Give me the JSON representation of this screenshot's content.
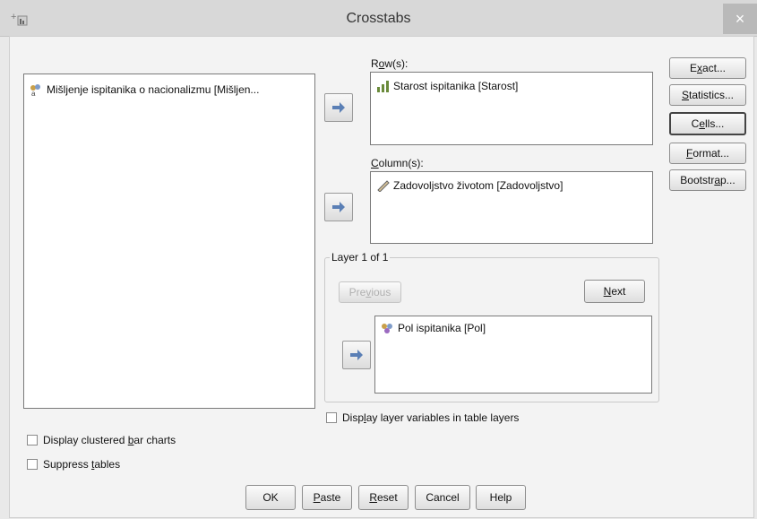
{
  "window": {
    "title": "Crosstabs",
    "close_glyph": "×"
  },
  "source_list": {
    "items": [
      {
        "label": "Mišljenje ispitanika o nacionalizmu [Mišljen...",
        "icon": "nominal-string-icon"
      }
    ]
  },
  "rows": {
    "label_pre": "R",
    "label_u": "o",
    "label_post": "w(s):",
    "items": [
      {
        "label": "Starost ispitanika [Starost]",
        "icon": "ordinal-icon"
      }
    ]
  },
  "columns": {
    "label_pre": "",
    "label_u": "C",
    "label_post": "olumn(s):",
    "items": [
      {
        "label": "Zadovoljstvo životom [Zadovoljstvo]",
        "icon": "scale-icon"
      }
    ]
  },
  "layer": {
    "title": "Layer 1 of 1",
    "previous": {
      "pre": "Pre",
      "u": "v",
      "post": "ious"
    },
    "next": {
      "pre": "",
      "u": "N",
      "post": "ext"
    },
    "items": [
      {
        "label": "Pol ispitanika [Pol]",
        "icon": "nominal-icon"
      }
    ]
  },
  "side_buttons": {
    "exact": {
      "pre": "E",
      "u": "x",
      "post": "act..."
    },
    "statistics": {
      "pre": "",
      "u": "S",
      "post": "tatistics..."
    },
    "cells": {
      "pre": "C",
      "u": "e",
      "post": "lls..."
    },
    "format": {
      "pre": "",
      "u": "F",
      "post": "ormat..."
    },
    "bootstrap": {
      "pre": "Bootstr",
      "u": "a",
      "post": "p..."
    }
  },
  "options": {
    "layer_vars": {
      "pre": "Disp",
      "u": "l",
      "post": "ay layer variables in table layers",
      "checked": false
    },
    "clustered": {
      "pre": "Display clustered ",
      "u": "b",
      "post": "ar charts",
      "checked": false
    },
    "suppress": {
      "pre": "Suppress ",
      "u": "t",
      "post": "ables",
      "checked": false
    }
  },
  "footer": {
    "ok": {
      "pre": "OK",
      "u": "",
      "post": ""
    },
    "paste": {
      "pre": "",
      "u": "P",
      "post": "aste"
    },
    "reset": {
      "pre": "",
      "u": "R",
      "post": "eset"
    },
    "cancel": {
      "pre": "Cancel",
      "u": "",
      "post": ""
    },
    "help": {
      "pre": "Help",
      "u": "",
      "post": ""
    }
  },
  "colors": {
    "title_bar": "#d8d8d8",
    "dialog_bg": "#f3f3f3",
    "list_bg": "#ffffff",
    "arrow": "#5a7fb5"
  }
}
